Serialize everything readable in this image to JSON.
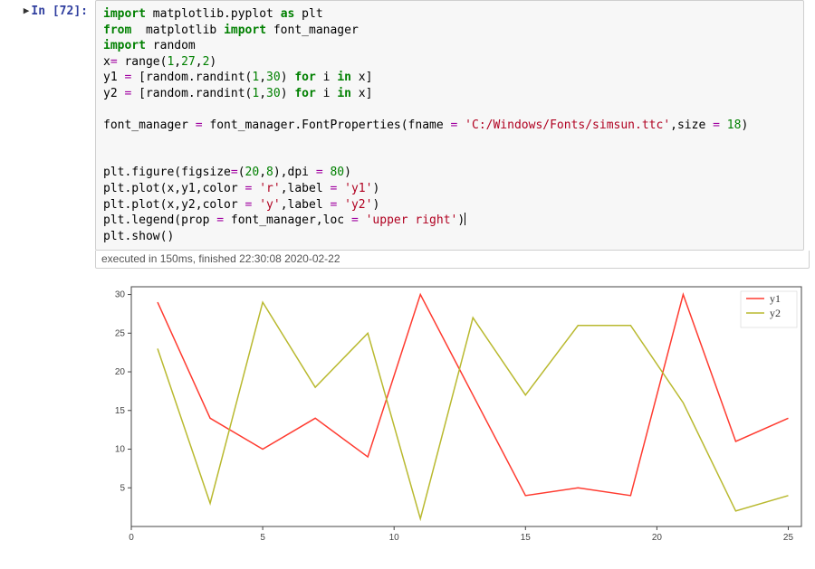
{
  "cell": {
    "prompt_label": "In  [72]:",
    "code_lines": [
      [
        {
          "t": "import",
          "c": "kw"
        },
        {
          "t": " matplotlib.pyplot ",
          "c": "nm"
        },
        {
          "t": "as",
          "c": "kw"
        },
        {
          "t": " plt",
          "c": "nm"
        }
      ],
      [
        {
          "t": "from",
          "c": "kw"
        },
        {
          "t": "  matplotlib ",
          "c": "nm"
        },
        {
          "t": "import",
          "c": "kw"
        },
        {
          "t": " font_manager",
          "c": "nm"
        }
      ],
      [
        {
          "t": "import",
          "c": "kw"
        },
        {
          "t": " random",
          "c": "nm"
        }
      ],
      [
        {
          "t": "x",
          "c": "nm"
        },
        {
          "t": "=",
          "c": "op"
        },
        {
          "t": " range(",
          "c": "nm"
        },
        {
          "t": "1",
          "c": "num"
        },
        {
          "t": ",",
          "c": "nm"
        },
        {
          "t": "27",
          "c": "num"
        },
        {
          "t": ",",
          "c": "nm"
        },
        {
          "t": "2",
          "c": "num"
        },
        {
          "t": ")",
          "c": "nm"
        }
      ],
      [
        {
          "t": "y1 ",
          "c": "nm"
        },
        {
          "t": "=",
          "c": "op"
        },
        {
          "t": " [random.randint(",
          "c": "nm"
        },
        {
          "t": "1",
          "c": "num"
        },
        {
          "t": ",",
          "c": "nm"
        },
        {
          "t": "30",
          "c": "num"
        },
        {
          "t": ") ",
          "c": "nm"
        },
        {
          "t": "for",
          "c": "kw"
        },
        {
          "t": " i ",
          "c": "nm"
        },
        {
          "t": "in",
          "c": "kw"
        },
        {
          "t": " x]",
          "c": "nm"
        }
      ],
      [
        {
          "t": "y2 ",
          "c": "nm"
        },
        {
          "t": "=",
          "c": "op"
        },
        {
          "t": " [random.randint(",
          "c": "nm"
        },
        {
          "t": "1",
          "c": "num"
        },
        {
          "t": ",",
          "c": "nm"
        },
        {
          "t": "30",
          "c": "num"
        },
        {
          "t": ") ",
          "c": "nm"
        },
        {
          "t": "for",
          "c": "kw"
        },
        {
          "t": " i ",
          "c": "nm"
        },
        {
          "t": "in",
          "c": "kw"
        },
        {
          "t": " x]",
          "c": "nm"
        }
      ],
      [],
      [
        {
          "t": "font_manager ",
          "c": "nm"
        },
        {
          "t": "=",
          "c": "op"
        },
        {
          "t": " font_manager.FontProperties(fname ",
          "c": "nm"
        },
        {
          "t": "=",
          "c": "op"
        },
        {
          "t": " ",
          "c": "nm"
        },
        {
          "t": "'C:/Windows/Fonts/simsun.ttc'",
          "c": "str"
        },
        {
          "t": ",size ",
          "c": "nm"
        },
        {
          "t": "=",
          "c": "op"
        },
        {
          "t": " ",
          "c": "nm"
        },
        {
          "t": "18",
          "c": "num"
        },
        {
          "t": ")",
          "c": "nm"
        }
      ],
      [],
      [],
      [
        {
          "t": "plt.figure(figsize",
          "c": "nm"
        },
        {
          "t": "=",
          "c": "op"
        },
        {
          "t": "(",
          "c": "nm"
        },
        {
          "t": "20",
          "c": "num"
        },
        {
          "t": ",",
          "c": "nm"
        },
        {
          "t": "8",
          "c": "num"
        },
        {
          "t": "),dpi ",
          "c": "nm"
        },
        {
          "t": "=",
          "c": "op"
        },
        {
          "t": " ",
          "c": "nm"
        },
        {
          "t": "80",
          "c": "num"
        },
        {
          "t": ")",
          "c": "nm"
        }
      ],
      [
        {
          "t": "plt.plot(x,y1,color ",
          "c": "nm"
        },
        {
          "t": "=",
          "c": "op"
        },
        {
          "t": " ",
          "c": "nm"
        },
        {
          "t": "'r'",
          "c": "str"
        },
        {
          "t": ",label ",
          "c": "nm"
        },
        {
          "t": "=",
          "c": "op"
        },
        {
          "t": " ",
          "c": "nm"
        },
        {
          "t": "'y1'",
          "c": "str"
        },
        {
          "t": ")",
          "c": "nm"
        }
      ],
      [
        {
          "t": "plt.plot(x,y2,color ",
          "c": "nm"
        },
        {
          "t": "=",
          "c": "op"
        },
        {
          "t": " ",
          "c": "nm"
        },
        {
          "t": "'y'",
          "c": "str"
        },
        {
          "t": ",label ",
          "c": "nm"
        },
        {
          "t": "=",
          "c": "op"
        },
        {
          "t": " ",
          "c": "nm"
        },
        {
          "t": "'y2'",
          "c": "str"
        },
        {
          "t": ")",
          "c": "nm"
        }
      ],
      [
        {
          "t": "plt.legend(prop ",
          "c": "nm"
        },
        {
          "t": "=",
          "c": "op"
        },
        {
          "t": " font_manager,loc ",
          "c": "nm"
        },
        {
          "t": "=",
          "c": "op"
        },
        {
          "t": " ",
          "c": "nm"
        },
        {
          "t": "'upper right'",
          "c": "str"
        },
        {
          "t": ")",
          "c": "nm"
        },
        {
          "t": "__CURSOR__",
          "c": "cursor"
        }
      ],
      [
        {
          "t": "plt.show()",
          "c": "nm"
        }
      ]
    ],
    "exec_info": "executed in 150ms, finished 22:30:08 2020-02-22"
  },
  "chart_data": {
    "type": "line",
    "x": [
      1,
      3,
      5,
      7,
      9,
      11,
      13,
      15,
      17,
      19,
      21,
      23,
      25
    ],
    "series": [
      {
        "name": "y1",
        "color": "#ff3b30",
        "values": [
          29,
          14,
          10,
          14,
          9,
          30,
          17,
          4,
          5,
          4,
          30,
          11,
          14
        ]
      },
      {
        "name": "y2",
        "color": "#b9b92f",
        "values": [
          23,
          3,
          29,
          18,
          25,
          1,
          27,
          17,
          26,
          26,
          16,
          2,
          4
        ]
      }
    ],
    "x_ticks": [
      0,
      5,
      10,
      15,
      20,
      25
    ],
    "y_ticks": [
      5,
      10,
      15,
      20,
      25,
      30
    ],
    "xlim": [
      0,
      25.5
    ],
    "ylim": [
      0,
      31
    ],
    "legend_pos": "upper right"
  }
}
